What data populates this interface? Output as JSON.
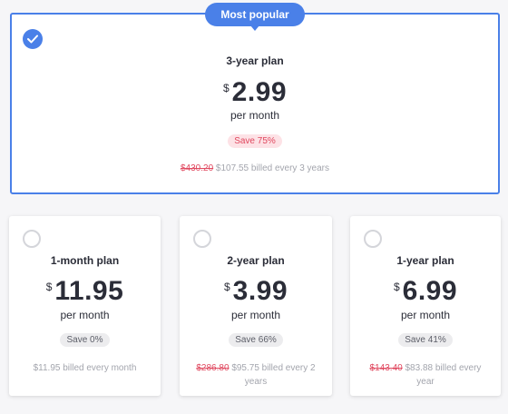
{
  "featured": {
    "badge": "Most popular",
    "plan": "3-year plan",
    "currency": "$",
    "price": "2.99",
    "period": "per month",
    "save": "Save 75%",
    "original_price": "$430.20",
    "billed": "$107.55 billed every 3 years",
    "selected": true
  },
  "plans": [
    {
      "plan": "1-month plan",
      "currency": "$",
      "price": "11.95",
      "period": "per month",
      "save": "Save 0%",
      "original_price": "",
      "billed": "$11.95 billed every month",
      "selected": false
    },
    {
      "plan": "2-year plan",
      "currency": "$",
      "price": "3.99",
      "period": "per month",
      "save": "Save 66%",
      "original_price": "$286.80",
      "billed": "$95.75 billed every 2 years",
      "selected": false
    },
    {
      "plan": "1-year plan",
      "currency": "$",
      "price": "6.99",
      "period": "per month",
      "save": "Save 41%",
      "original_price": "$143.40",
      "billed": "$83.88 billed every year",
      "selected": false
    }
  ],
  "colors": {
    "accent": "#4a80e8",
    "strike": "#e0485f",
    "save_hot_bg": "#fde2e6"
  },
  "icons": {
    "selected": "checkmark-icon",
    "unselected": "radio-circle-icon"
  }
}
